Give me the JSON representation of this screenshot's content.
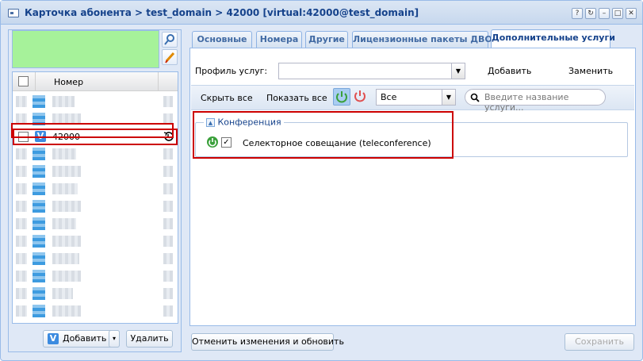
{
  "window": {
    "title": "Карточка абонента > test_domain > 42000 [virtual:42000@test_domain]",
    "controls": [
      "?",
      "↻",
      "–",
      "□",
      "✕"
    ]
  },
  "left_panel": {
    "grid_header": "Номер",
    "selected_row": {
      "badge": "V",
      "number": "42000"
    },
    "add_button": "Добавить",
    "delete_button": "Удалить"
  },
  "tabs": [
    "Основные",
    "Номера",
    "Другие",
    "Лицензионные пакеты ДВО",
    "Дополнительные услуги"
  ],
  "services": {
    "profile_label": "Профиль услуг:",
    "add_label": "Добавить",
    "replace_label": "Заменить",
    "hide_all": "Скрыть все",
    "show_all": "Показать все",
    "filter_value": "Все",
    "search_placeholder": "Введите название услуги...",
    "group_title": "Конференция",
    "service_name": "Селекторное совещание (teleconference)"
  },
  "footer": {
    "reset_button": "Отменить изменения и обновить",
    "save_button": "Сохранить"
  }
}
